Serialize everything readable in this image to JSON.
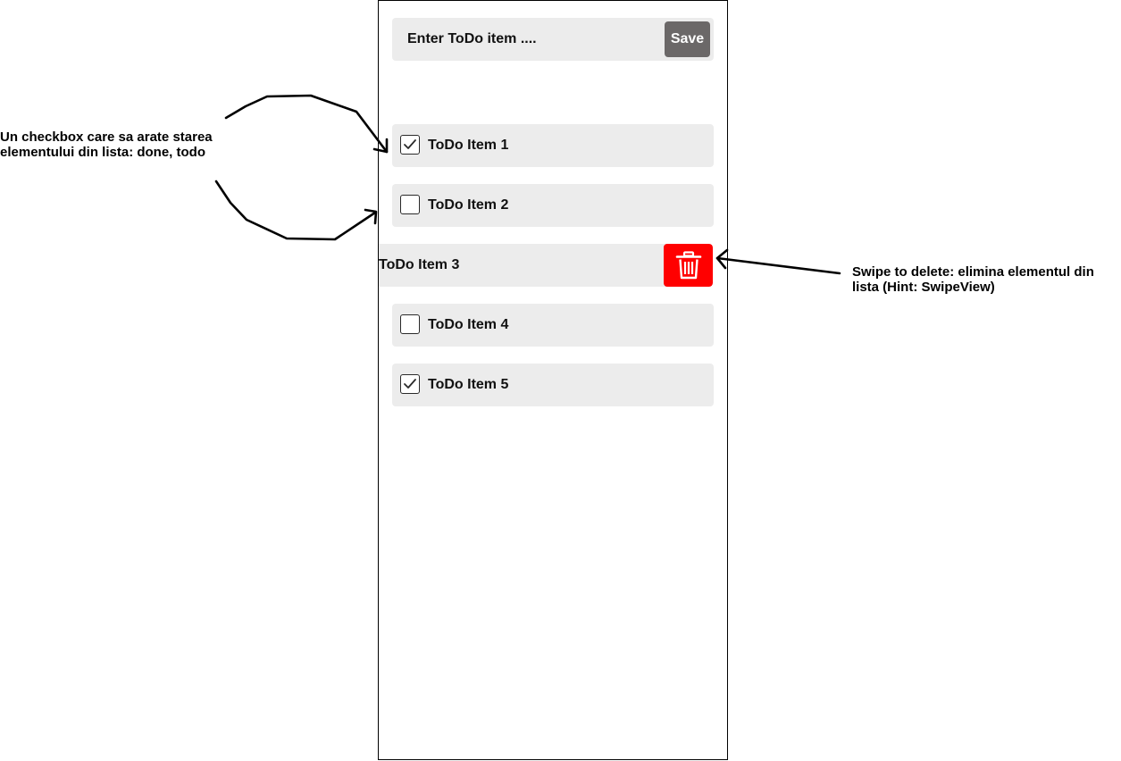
{
  "entry": {
    "placeholder": "Enter ToDo item ....",
    "save_label": "Save"
  },
  "todos": [
    {
      "label": "ToDo Item 1",
      "done": true
    },
    {
      "label": "ToDo Item 2",
      "done": false
    },
    {
      "label": "ToDo Item 3",
      "done": false,
      "swiped": true
    },
    {
      "label": "ToDo Item 4",
      "done": false
    },
    {
      "label": "ToDo Item 5",
      "done": true
    }
  ],
  "delete_action": {
    "icon": "trash-icon",
    "color": "#ff0000"
  },
  "annotations": {
    "checkbox_note": "Un checkbox care sa arate starea elementului din lista: done, todo",
    "swipe_note": "Swipe to delete: elimina elementul din lista (Hint: SwipeView)"
  },
  "colors": {
    "row_background": "#ececec",
    "save_button": "#6b6868",
    "delete_button": "#ff0000"
  }
}
